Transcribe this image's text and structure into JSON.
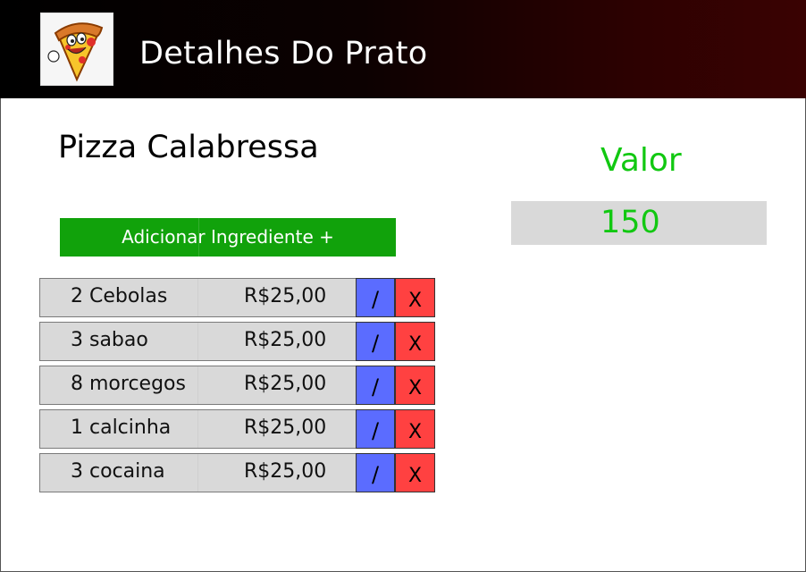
{
  "header": {
    "title": "Detalhes Do Prato",
    "logo_icon": "pizza-mascot-icon"
  },
  "dish": {
    "name": "Pizza Calabressa"
  },
  "add_ingredient_button": {
    "label": "Adicionar Ingrediente +"
  },
  "price_panel": {
    "label": "Valor",
    "value": "150"
  },
  "ingredients": [
    {
      "name": "2 Cebolas",
      "price": "R$25,00",
      "edit_label": "/",
      "delete_label": "X"
    },
    {
      "name": "3 sabao",
      "price": "R$25,00",
      "edit_label": "/",
      "delete_label": "X"
    },
    {
      "name": "8 morcegos",
      "price": "R$25,00",
      "edit_label": "/",
      "delete_label": "X"
    },
    {
      "name": "1 calcinha",
      "price": "R$25,00",
      "edit_label": "/",
      "delete_label": "X"
    },
    {
      "name": "3 cocaina",
      "price": "R$25,00",
      "edit_label": "/",
      "delete_label": "X"
    }
  ],
  "colors": {
    "header_dark": "#000000",
    "header_red": "#3a0202",
    "accent_green": "#11a20b",
    "value_green": "#11c811",
    "edit_blue": "#5b6cff",
    "delete_red": "#ff4141",
    "cell_gray": "#d9d9d9"
  }
}
